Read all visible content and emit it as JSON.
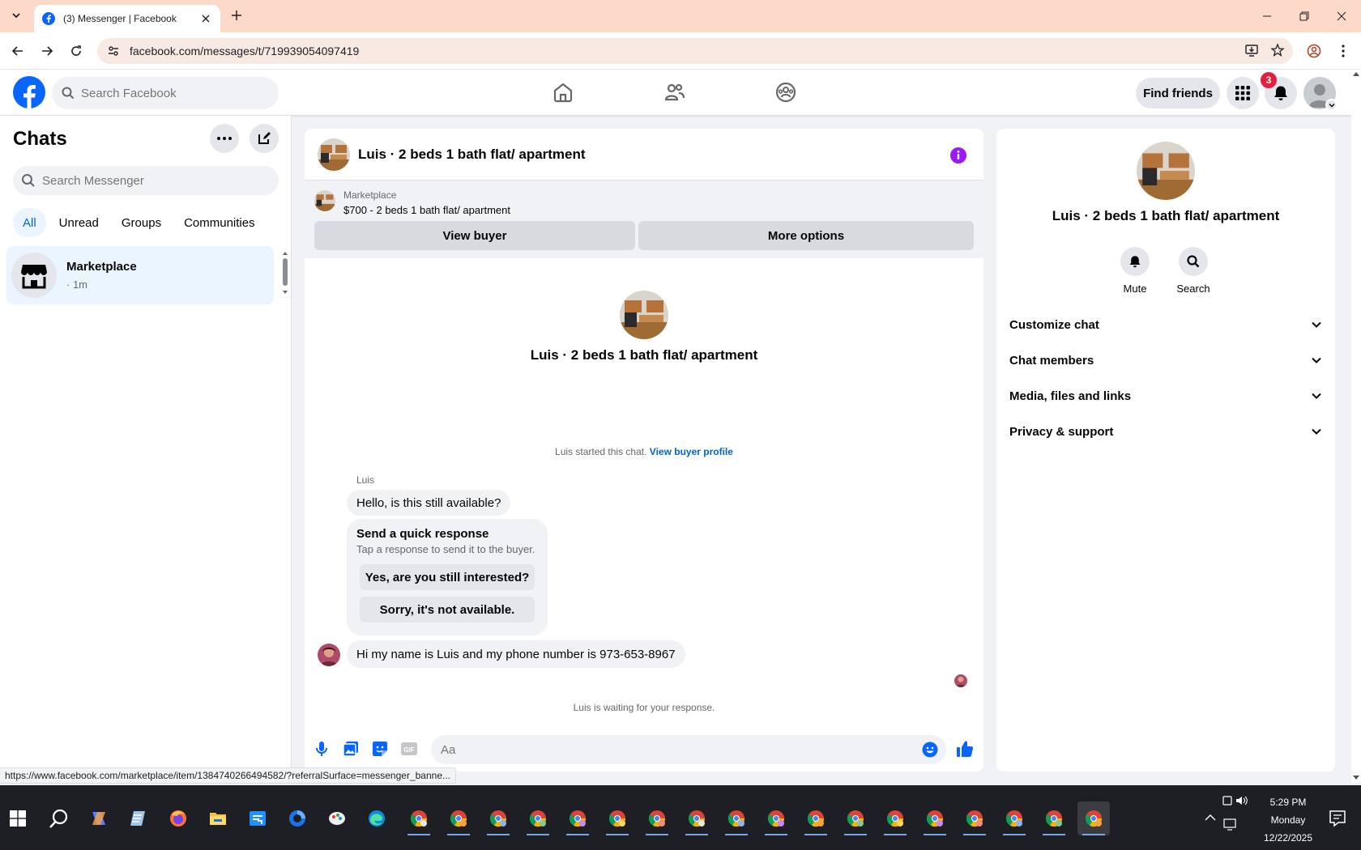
{
  "browser": {
    "tab_title": "(3) Messenger | Facebook",
    "url": "facebook.com/messages/t/719939054097419",
    "status_url": "https://www.facebook.com/marketplace/item/1384740266494582/?referralSurface=messenger_banne..."
  },
  "fb_nav": {
    "search_placeholder": "Search Facebook",
    "find_friends": "Find friends",
    "notification_count": "3",
    "brand_color": "#0866ff"
  },
  "chats": {
    "title": "Chats",
    "search_placeholder": "Search Messenger",
    "filters": [
      "All",
      "Unread",
      "Groups",
      "Communities"
    ],
    "active_filter": "All",
    "items": [
      {
        "name": "Marketplace",
        "time": "· 1m"
      }
    ]
  },
  "conversation": {
    "title": "Luis · 2 beds 1 bath flat/ apartment",
    "banner": {
      "label": "Marketplace",
      "price_line": "$700 - 2 beds 1 bath flat/ apartment",
      "view_buyer": "View buyer",
      "more_options": "More options"
    },
    "profile_name": "Luis · 2 beds 1 bath flat/ apartment",
    "started_text": "Luis started this chat.",
    "started_link": "View buyer profile",
    "sender": "Luis",
    "messages": [
      "Hello, is this still available?",
      "Hi my name is Luis and my phone number is 973-653-8967"
    ],
    "quick_response": {
      "title": "Send a quick response",
      "subtitle": "Tap a response to send it to the buyer.",
      "options": [
        "Yes, are you still interested?",
        "Sorry, it's not available."
      ]
    },
    "waiting": "Luis is waiting for your response.",
    "composer_placeholder": "Aa"
  },
  "info_panel": {
    "name": "Luis · 2 beds 1 bath flat/ apartment",
    "actions": [
      "Mute",
      "Search"
    ],
    "sections": [
      "Customize chat",
      "Chat members",
      "Media, files and links",
      "Privacy & support"
    ]
  },
  "taskbar": {
    "time": "5:29 PM",
    "day": "Monday",
    "date": "12/22/2025"
  }
}
